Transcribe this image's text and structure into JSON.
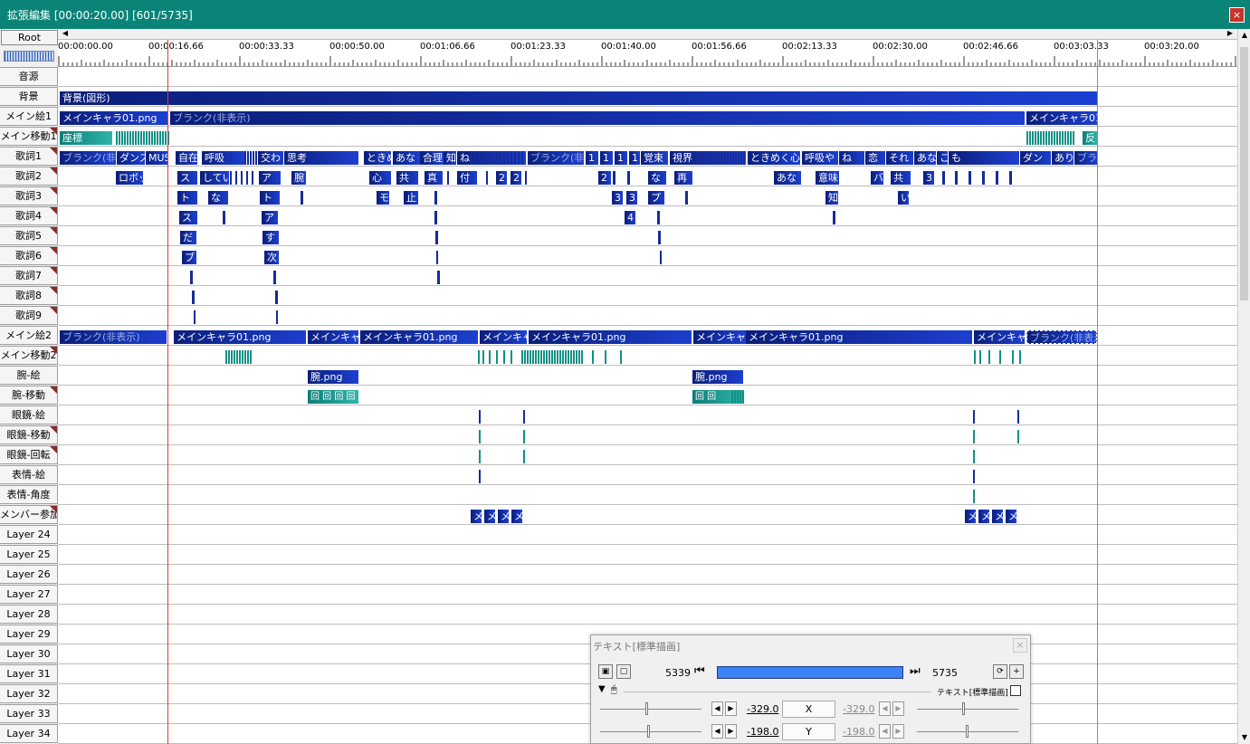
{
  "window": {
    "title": "拡張編集 [00:00:20.00] [601/5735]",
    "close_icon": "×"
  },
  "root_button": "Root",
  "ruler": {
    "ticks": [
      "00:00:00.00",
      "00:00:16.66",
      "00:00:33.33",
      "00:00:50.00",
      "00:01:06.66",
      "00:01:23.33",
      "00:01:40.00",
      "00:01:56.66",
      "00:02:13.33",
      "00:02:30.00",
      "00:02:46.66",
      "00:03:03.33",
      "00:03:20.00"
    ]
  },
  "layers": [
    {
      "name": "音源",
      "flag": false
    },
    {
      "name": "背景",
      "flag": false
    },
    {
      "name": "メイン絵1",
      "flag": false
    },
    {
      "name": "メイン移動1",
      "flag": true
    },
    {
      "name": "歌詞1",
      "flag": true
    },
    {
      "name": "歌詞2",
      "flag": true
    },
    {
      "name": "歌詞3",
      "flag": true
    },
    {
      "name": "歌詞4",
      "flag": true
    },
    {
      "name": "歌詞5",
      "flag": true
    },
    {
      "name": "歌詞6",
      "flag": true
    },
    {
      "name": "歌詞7",
      "flag": true
    },
    {
      "name": "歌詞8",
      "flag": true
    },
    {
      "name": "歌詞9",
      "flag": true
    },
    {
      "name": "メイン絵2",
      "flag": false
    },
    {
      "name": "メイン移動2",
      "flag": true
    },
    {
      "name": "腕-絵",
      "flag": false
    },
    {
      "name": "腕-移動",
      "flag": true
    },
    {
      "name": "眼鏡-絵",
      "flag": false
    },
    {
      "name": "眼鏡-移動",
      "flag": true
    },
    {
      "name": "眼鏡-回転",
      "flag": true
    },
    {
      "name": "表情-絵",
      "flag": false
    },
    {
      "name": "表情-角度",
      "flag": false
    },
    {
      "name": "メンバー参加",
      "flag": true
    },
    {
      "name": "Layer 24",
      "flag": false
    },
    {
      "name": "Layer 25",
      "flag": false
    },
    {
      "name": "Layer 26",
      "flag": false
    },
    {
      "name": "Layer 27",
      "flag": false
    },
    {
      "name": "Layer 28",
      "flag": false
    },
    {
      "name": "Layer 29",
      "flag": false
    },
    {
      "name": "Layer 30",
      "flag": false
    },
    {
      "name": "Layer 31",
      "flag": false
    },
    {
      "name": "Layer 32",
      "flag": false
    },
    {
      "name": "Layer 33",
      "flag": false
    },
    {
      "name": "Layer 34",
      "flag": false
    }
  ],
  "clips": {
    "bg": "背景(図形)",
    "main1_a": "メインキャラ01.png",
    "main1_blank": "ブランク(非表示)",
    "main1_b": "メインキャラ01.p",
    "move1_a": "座標",
    "move1_b": "反",
    "lyr1_blank1": "ブランク(非表",
    "lyr1_dance": "ダンス",
    "lyr1_mus": "MUS",
    "lyr1_jiza": "自在",
    "lyr1_kokyu": "呼吸",
    "lyr1_kawa": "交わ",
    "lyr1_shiko": "思考",
    "lyr1_tokime": "ときめ",
    "lyr1_ana": "あな",
    "lyr1_gori": "合理",
    "lyr1_chi": "知",
    "lyr1_ne": "ね",
    "lyr1_blank2": "ブランク(非",
    "lyr1_1a": "1",
    "lyr1_1b": "1",
    "lyr1_1c": "1",
    "lyr1_1d": "1",
    "lyr1_kaku": "覚束",
    "lyr1_shikai": "視界",
    "lyr1_tokimeku": "ときめく心の",
    "lyr1_kokyuya": "呼吸や",
    "lyr1_ne2": "ね",
    "lyr1_koi": "恋",
    "lyr1_sore": "それ",
    "lyr1_ana2": "あな",
    "lyr1_ko": "こ",
    "lyr1_mo": "も",
    "lyr1_dan": "ダン",
    "lyr1_ari": "あり",
    "lyr1_bura": "ブラ",
    "lyr2_robo": "ロボッ",
    "lyr2_su": "ス",
    "lyr2_shite": "してい",
    "lyr2_ai": "ア",
    "lyr2_ude": "腕",
    "lyr2_kokoro": "心",
    "lyr2_kyo": "共",
    "lyr2_shin": "真",
    "lyr2_tsuki": "付",
    "lyr2_2a": "2",
    "lyr2_2b": "2",
    "lyr2_2c": "2",
    "lyr2_na": "な",
    "lyr2_sai": "再",
    "lyr2_ana": "あな",
    "lyr2_imi": "意味",
    "lyr2_ba": "バ",
    "lyr2_kyo2": "共",
    "lyr2_3": "3",
    "lyr3_to": "ト",
    "lyr3_na": "な",
    "lyr3_to2": "ト",
    "lyr3_mo": "モ",
    "lyr3_jou": "止",
    "lyr3_3a": "3",
    "lyr3_3b": "3",
    "lyr3_bu": "プ",
    "lyr3_shiru": "知",
    "lyr3_i": "い",
    "lyr4_su": "ス",
    "lyr4_a": "ア",
    "lyr4_4": "4",
    "lyr5_da": "だ",
    "lyr5_su": "す",
    "lyr6_bu": "ブ",
    "lyr6_tsugi": "次",
    "main2_blank": "ブランク(非表示)",
    "main2_a": "メインキャラ01.png",
    "main2_b": "メインキャラ",
    "main2_c": "メインキャラ01.png",
    "main2_d": "メインキャ",
    "main2_e": "メインキャラ01.png",
    "main2_f": "メインキャラ",
    "main2_g": "メインキャラ01.png",
    "main2_h": "メインキャ",
    "main2_blank2": "ブランク(非表示",
    "arm_a": "腕.png",
    "arm_b": "腕.png",
    "armmove_a": "回 回 回 回",
    "armmove_b": "回 回",
    "member": "メ"
  },
  "panel": {
    "title": "テキスト[標準描画]",
    "frame_start": "5339",
    "frame_end": "5735",
    "object_label": "テキスト[標準描画]",
    "x_value": "-329.0",
    "x_value2": "-329.0",
    "x_label": "X",
    "y_value": "-198.0",
    "y_value2": "-198.0",
    "y_label": "Y"
  }
}
